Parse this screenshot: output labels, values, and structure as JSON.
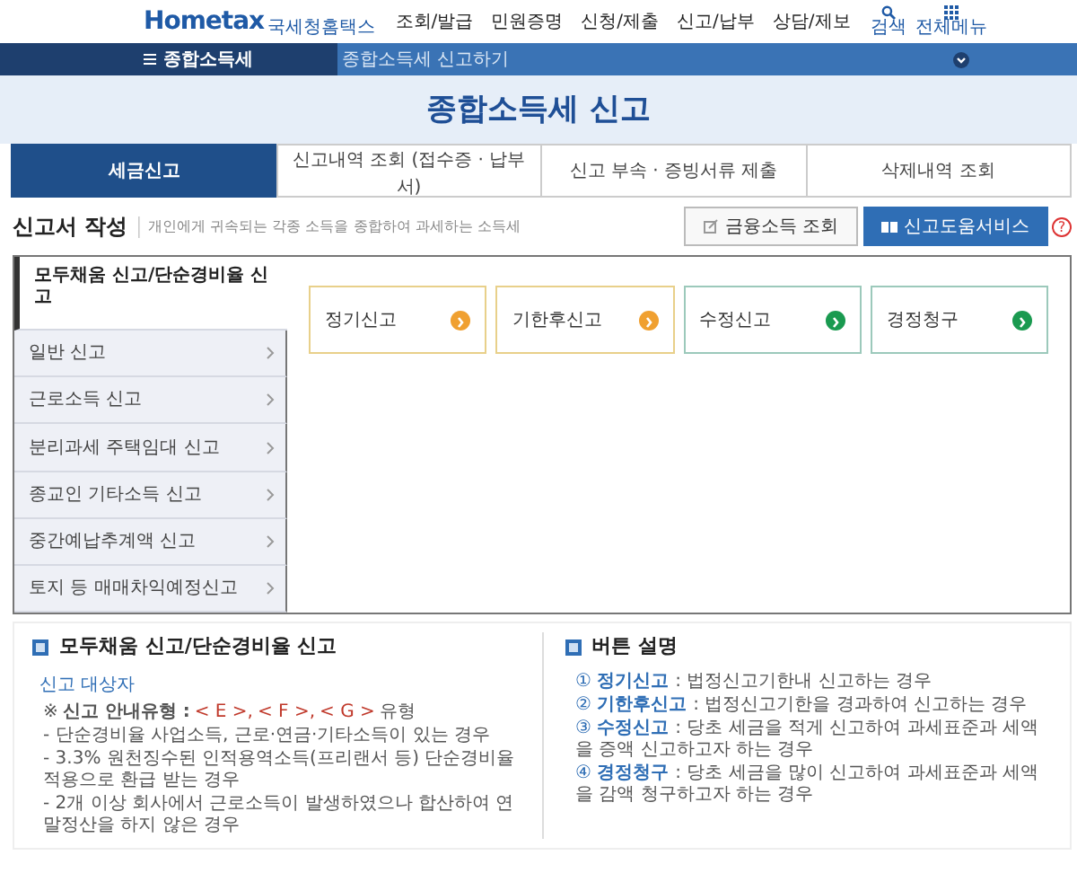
{
  "header": {
    "logo": "Hometax",
    "logo_sub": "국세청홈택스",
    "nav": [
      "조회/발급",
      "민원증명",
      "신청/제출",
      "신고/납부",
      "상담/제보"
    ],
    "tools": [
      {
        "kind": "search",
        "label": "검색"
      },
      {
        "kind": "grid",
        "label": "전체메뉴"
      }
    ]
  },
  "location_bar": {
    "menu": "종합소득세",
    "breadcrumb": "종합소득세 신고하기"
  },
  "page_title": "종합소득세 신고",
  "tabs": [
    {
      "label": "세금신고",
      "selected": true
    },
    {
      "label": "신고내역 조회 (접수증 · 납부서)",
      "selected": false
    },
    {
      "label": "신고 부속 · 증빙서류 제출",
      "selected": false
    },
    {
      "label": "삭제내역 조회",
      "selected": false
    }
  ],
  "section": {
    "title": "신고서 작성",
    "description": "개인에게 귀속되는 각종 소득을 종합하여 과세하는 소득세",
    "buttons": [
      {
        "kind": "outline",
        "label": "금융소득 조회"
      },
      {
        "kind": "primary",
        "label": "신고도움서비스"
      }
    ],
    "help": "?"
  },
  "menu": [
    {
      "label": "모두채움 신고/단순경비율 신고",
      "selected": true
    },
    {
      "label": "일반 신고",
      "selected": false
    },
    {
      "label": "근로소득 신고",
      "selected": false
    },
    {
      "label": "분리과세 주택임대 신고",
      "selected": false
    },
    {
      "label": "종교인 기타소득 신고",
      "selected": false
    },
    {
      "label": "중간예납추계액 신고",
      "selected": false
    },
    {
      "label": "토지 등 매매차익예정신고",
      "selected": false
    }
  ],
  "options": [
    {
      "label": "정기신고",
      "color": "#f0a030"
    },
    {
      "label": "기한후신고",
      "color": "#f0a030"
    },
    {
      "label": "수정신고",
      "color": "#1a9a50"
    },
    {
      "label": "경정청구",
      "color": "#1a9a50"
    }
  ],
  "info": {
    "title": "모두채움 신고/단순경비율 신고",
    "subtitle": "신고 대상자",
    "note": {
      "mark": "※",
      "label": "신고 안내유형 :",
      "types": [
        "< E >,",
        "< F >,",
        "< G >"
      ],
      "suffix": "유형"
    },
    "items": [
      "- 단순경비율 사업소득, 근로·연금·기타소득이 있는 경우",
      "- 3.3% 원천징수된 인적용역소득(프리랜서 등) 단순경비율 적용으로 환급 받는 경우",
      "- 2개 이상 회사에서 근로소득이 발생하였으나 합산하여 연말정산을 하지 않은 경우"
    ]
  },
  "legend": {
    "title": "버튼 설명",
    "items": [
      {
        "number": "①",
        "term": "정기신고",
        "text": ": 법정신고기한내 신고하는 경우"
      },
      {
        "number": "②",
        "term": "기한후신고",
        "text": ": 법정신고기한을 경과하여 신고하는 경우"
      },
      {
        "number": "③",
        "term": "수정신고",
        "text": ": 당초 세금을 적게 신고하여 과세표준과 세액을 증액 신고하고자 하는 경우"
      },
      {
        "number": "④",
        "term": "경정청구",
        "text": ": 당초 세금을 많이 신고하여 과세표준과 세액을 감액 청구하고자 하는 경우"
      }
    ]
  }
}
